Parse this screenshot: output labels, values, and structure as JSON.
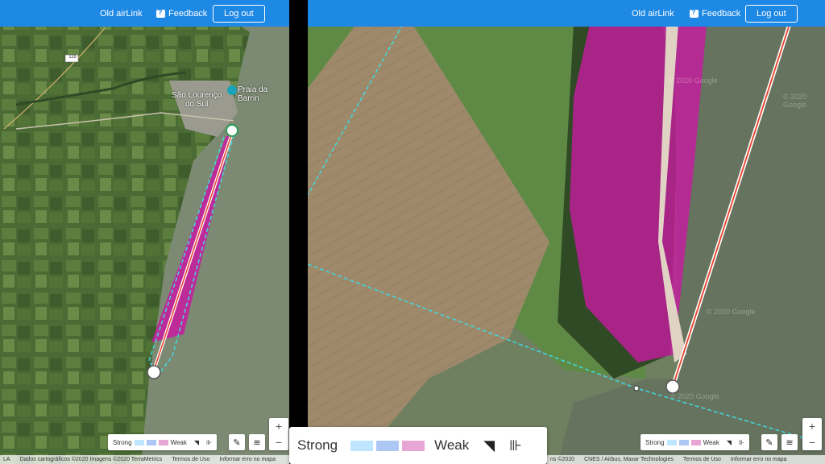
{
  "header": {
    "old_airlink": "Old airLink",
    "feedback": "Feedback",
    "logout": "Log out"
  },
  "left_map": {
    "road_shield": "116",
    "place_city_line1": "São Lourenço",
    "place_city_line2": "do Sul",
    "place_poi": "Praia da Barrin",
    "edge_label": "LA",
    "attribution": [
      "Dados cartográficos ©2020 Imagens ©2020 TerraMetrics",
      "Termos de Uso",
      "Informar erro no mapa"
    ]
  },
  "right_map": {
    "watermarks": [
      "© 2020 Google",
      "© 2020 Google",
      "© 2020 Google",
      "© 2020 Google"
    ],
    "attribution": [
      "ns ©2020",
      "CNES / Airbus, Maxar Technologies",
      "Termos de Uso",
      "Informar erro no mapa"
    ]
  },
  "legend": {
    "strong": "Strong",
    "weak": "Weak",
    "colors": [
      "#bfe6ff",
      "#aec8f5",
      "#e8a6d6"
    ]
  },
  "zoom": {
    "plus": "+",
    "minus": "−"
  },
  "icons": [
    "wifi-signal-icon",
    "tower-icon",
    "pencil-icon",
    "layers-icon",
    "feedback-icon",
    "radio-marker-icon"
  ],
  "colors": {
    "topbar": "#1e88e5",
    "coverage": "#c81aa0",
    "link_line": "#e8412a",
    "boundary": "#40d8e0"
  }
}
